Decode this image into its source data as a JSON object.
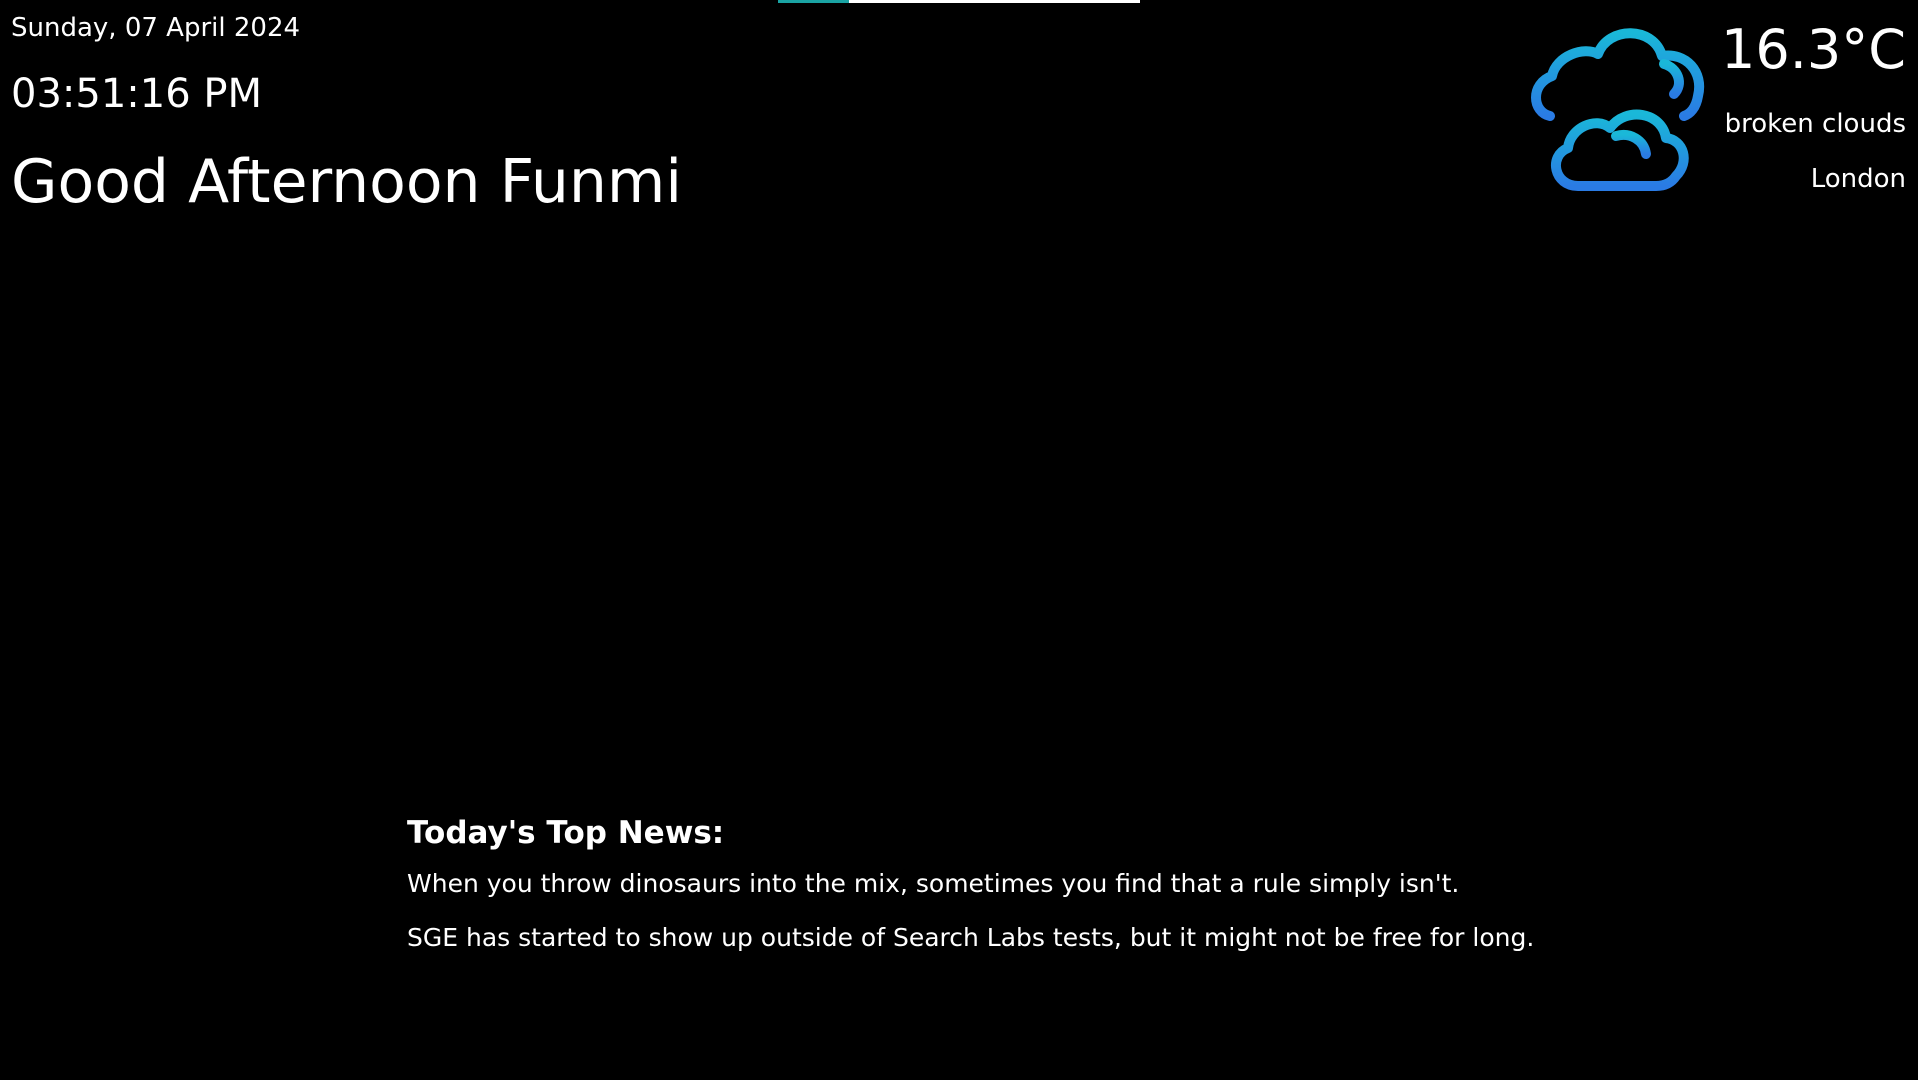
{
  "top_progress": {
    "value": 0.195,
    "fill_color": "#1aa3a3",
    "track_color": "#ffffff"
  },
  "clock": {
    "date": "Sunday, 07 April 2024",
    "time": "03:51:16 PM",
    "greeting": "Good Afternoon Funmi"
  },
  "weather": {
    "icon": "broken-clouds-icon",
    "temperature": "16.3°C",
    "condition": "broken clouds",
    "city": "London",
    "icon_gradient": [
      "#1ab8d8",
      "#2a7be4"
    ]
  },
  "news": {
    "heading": "Today's Top News:",
    "items": [
      "When you throw dinosaurs into the mix, sometimes you find that a rule simply isn't.",
      "SGE has started to show up outside of Search Labs tests, but it might not be free for long."
    ]
  }
}
